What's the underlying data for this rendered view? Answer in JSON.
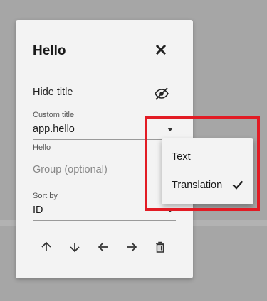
{
  "panel": {
    "title": "Hello",
    "hide_title_label": "Hide title",
    "custom_title": {
      "label": "Custom title",
      "value": "app.hello"
    },
    "hello_label": "Hello",
    "group": {
      "placeholder": "Group (optional)"
    },
    "sort": {
      "label": "Sort by",
      "value": "ID"
    }
  },
  "dropdown": {
    "options": [
      {
        "label": "Text",
        "selected": false
      },
      {
        "label": "Translation",
        "selected": true
      }
    ]
  },
  "colors": {
    "highlight": "#e21b24",
    "panel": "#f3f3f3",
    "backdrop": "#a6a6a6"
  },
  "icons": [
    "close-icon",
    "eye-slash-icon",
    "chevron-down-icon",
    "arrow-up-icon",
    "arrow-down-icon",
    "arrow-left-icon",
    "arrow-right-icon",
    "trash-icon",
    "check-icon"
  ]
}
